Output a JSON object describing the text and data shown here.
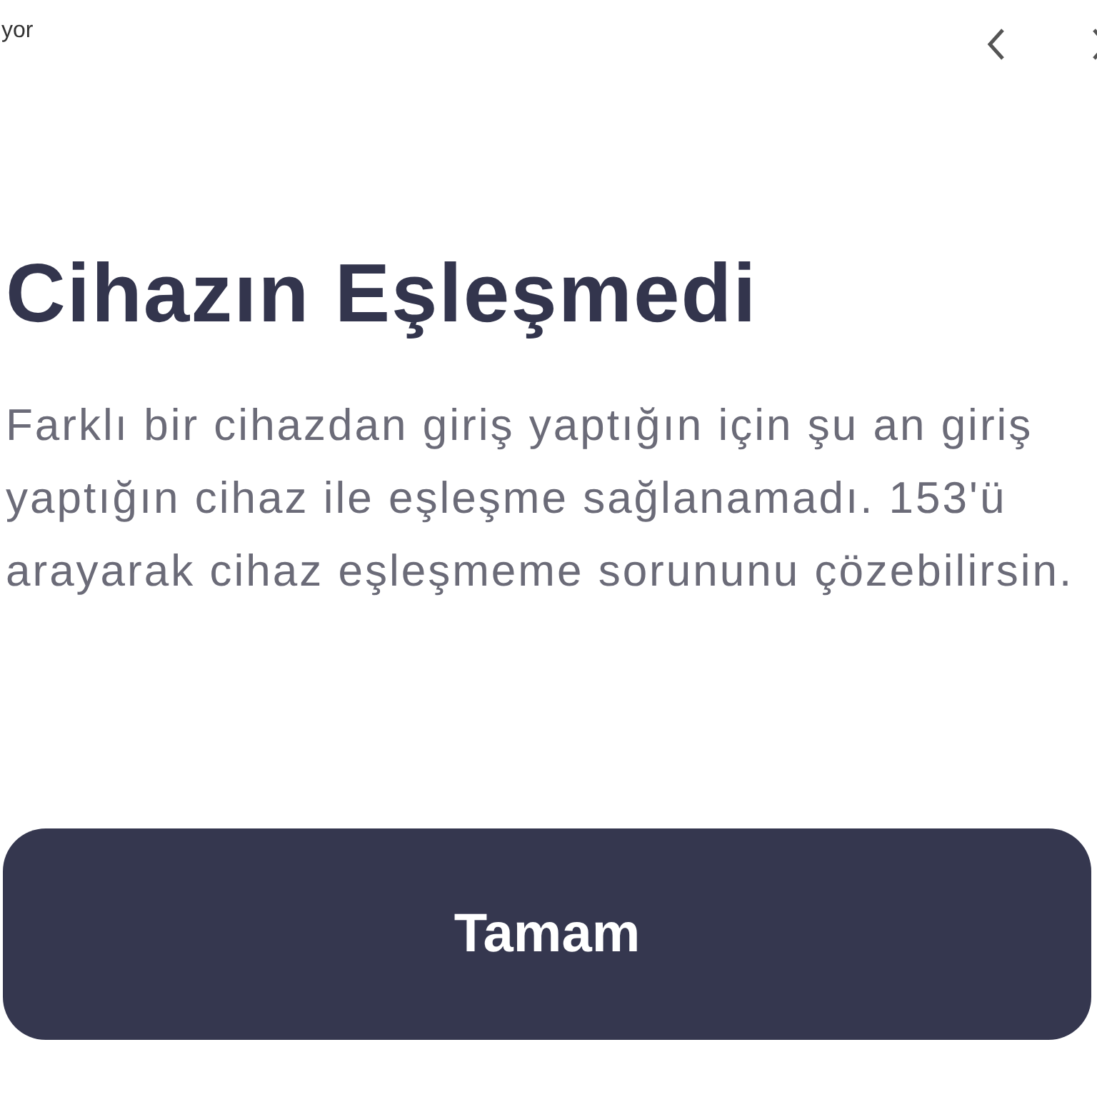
{
  "top_bar": {
    "text": "yor"
  },
  "dialog": {
    "title": "Cihazın Eşleşmedi",
    "message": "Farklı bir cihazdan giriş yaptığın için şu an giriş yaptığın cihaz ile eşleşme sağlanamadı. 153'ü arayarak cihaz eşleşmeme sorununu çözebilirsin.",
    "button": "Tamam"
  }
}
